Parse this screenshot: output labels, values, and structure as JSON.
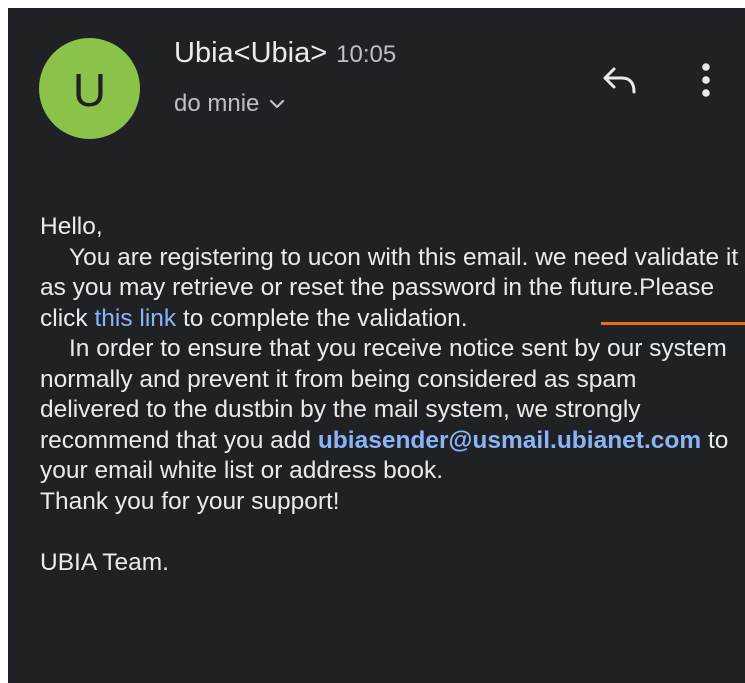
{
  "header": {
    "avatar_letter": "U",
    "sender": "Ubia<Ubia>",
    "time": "10:05",
    "recipient": "do mnie"
  },
  "icons": {
    "reply": "reply-icon",
    "more": "more-vert-icon",
    "expand": "chevron-down-icon"
  },
  "body": {
    "greeting": "Hello,",
    "p1_before_link": "You are registering to ucon with this email. we need validate it as you may retrieve or reset the password in the future.Please click ",
    "p1_link": "this link",
    "p1_after_link": " to complete the validation.",
    "p2_before_email": "In order to ensure that you receive notice sent by our system normally and prevent it from being considered as spam delivered to the dustbin by the mail system, we strongly recommend that you add ",
    "p2_email": "ubiasender@usmail.ubianet.com",
    "p2_after_email": " to your email white list or address book.",
    "thanks": "Thank you for your support!",
    "signature": "UBIA Team."
  },
  "colors": {
    "background": "#202124",
    "avatar": "#8bc34a",
    "link": "#8ab4f8",
    "annotation": "#e8710a"
  }
}
